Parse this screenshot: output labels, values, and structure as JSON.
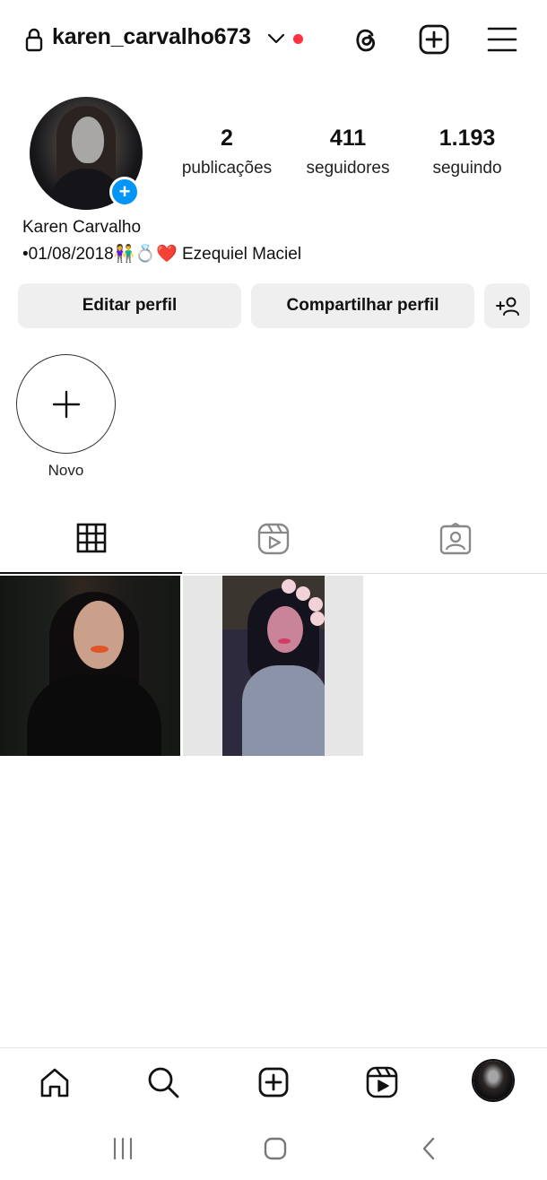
{
  "header": {
    "username": "karen_carvalho673",
    "notification_dot_color": "#ff3040",
    "icons": [
      "lock-icon",
      "chevron-down-icon",
      "threads-icon",
      "create-icon",
      "menu-icon"
    ]
  },
  "profile": {
    "display_name": "Karen Carvalho",
    "bio": "•01/08/2018👫💍❤️ Ezequiel Maciel",
    "stats": {
      "posts": {
        "value": "2",
        "label": "publicações"
      },
      "followers": {
        "value": "411",
        "label": "seguidores"
      },
      "following": {
        "value": "1.193",
        "label": "seguindo"
      }
    }
  },
  "actions": {
    "edit_label": "Editar perfil",
    "share_label": "Compartilhar perfil",
    "add_person_icon": "add-person-icon"
  },
  "highlights": {
    "new_label": "Novo"
  },
  "tabs": [
    "grid-icon",
    "reels-icon",
    "tagged-icon"
  ],
  "bottom_nav": [
    "home-icon",
    "search-icon",
    "create-icon",
    "reels-icon",
    "profile-avatar"
  ],
  "system_nav": [
    "recent-apps-icon",
    "home-button-icon",
    "back-icon"
  ],
  "colors": {
    "accent": "#0095f6",
    "button_bg": "#efefef"
  }
}
